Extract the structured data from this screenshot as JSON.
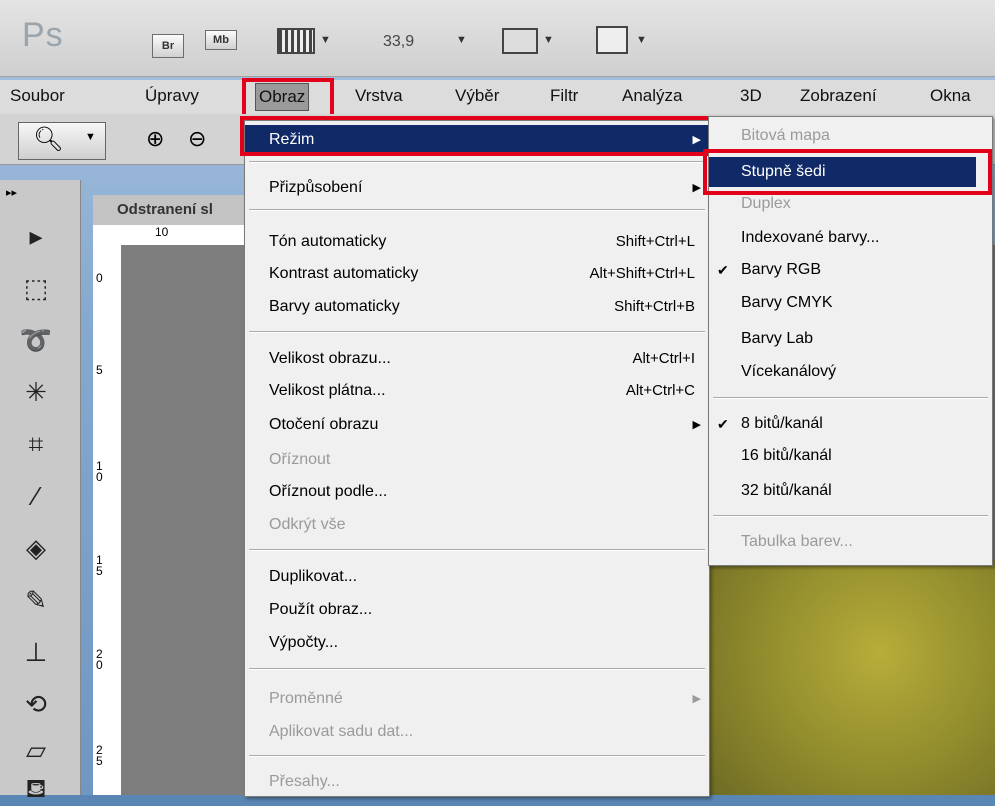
{
  "app": {
    "logo": "Ps",
    "bridge_label": "Br",
    "mini_bridge_label": "Mb",
    "zoom_value": "33,9"
  },
  "menubar": [
    {
      "label": "Soubor"
    },
    {
      "label": "Úpravy"
    },
    {
      "label": "Obraz"
    },
    {
      "label": "Vrstva"
    },
    {
      "label": "Výběr"
    },
    {
      "label": "Filtr"
    },
    {
      "label": "Analýza"
    },
    {
      "label": "3D"
    },
    {
      "label": "Zobrazení"
    },
    {
      "label": "Okna"
    }
  ],
  "document": {
    "tab_title": "Odstranení sl",
    "ruler_h_label": "10",
    "ruler_v_labels": [
      "0",
      "5",
      "1\n0",
      "1\n5",
      "2\n0",
      "2\n5"
    ]
  },
  "obraz_menu": {
    "items": [
      {
        "label": "Režim",
        "shortcut": "",
        "submenu": true,
        "disabled": false,
        "highlighted": true
      },
      {
        "label": "Přizpůsobení",
        "shortcut": "",
        "submenu": true,
        "disabled": false
      },
      {
        "label": "Tón automaticky",
        "shortcut": "Shift+Ctrl+L",
        "submenu": false,
        "disabled": false
      },
      {
        "label": "Kontrast automaticky",
        "shortcut": "Alt+Shift+Ctrl+L",
        "submenu": false,
        "disabled": false
      },
      {
        "label": "Barvy automaticky",
        "shortcut": "Shift+Ctrl+B",
        "submenu": false,
        "disabled": false
      },
      {
        "label": "Velikost obrazu...",
        "shortcut": "Alt+Ctrl+I",
        "submenu": false,
        "disabled": false
      },
      {
        "label": "Velikost plátna...",
        "shortcut": "Alt+Ctrl+C",
        "submenu": false,
        "disabled": false
      },
      {
        "label": "Otočení obrazu",
        "shortcut": "",
        "submenu": true,
        "disabled": false
      },
      {
        "label": "Oříznout",
        "shortcut": "",
        "submenu": false,
        "disabled": true
      },
      {
        "label": "Oříznout podle...",
        "shortcut": "",
        "submenu": false,
        "disabled": false
      },
      {
        "label": "Odkrýt vše",
        "shortcut": "",
        "submenu": false,
        "disabled": true
      },
      {
        "label": "Duplikovat...",
        "shortcut": "",
        "submenu": false,
        "disabled": false
      },
      {
        "label": "Použít obraz...",
        "shortcut": "",
        "submenu": false,
        "disabled": false
      },
      {
        "label": "Výpočty...",
        "shortcut": "",
        "submenu": false,
        "disabled": false
      },
      {
        "label": "Proměnné",
        "shortcut": "",
        "submenu": true,
        "disabled": true
      },
      {
        "label": "Aplikovat sadu dat...",
        "shortcut": "",
        "submenu": false,
        "disabled": true
      },
      {
        "label": "Přesahy...",
        "shortcut": "",
        "submenu": false,
        "disabled": true
      }
    ]
  },
  "rezim_submenu": {
    "items": [
      {
        "label": "Bitová mapa",
        "checked": false,
        "disabled": true
      },
      {
        "label": "Stupně šedi",
        "checked": false,
        "disabled": false,
        "highlighted": true
      },
      {
        "label": "Duplex",
        "checked": false,
        "disabled": true
      },
      {
        "label": "Indexované barvy...",
        "checked": false,
        "disabled": false
      },
      {
        "label": "Barvy RGB",
        "checked": true,
        "disabled": false
      },
      {
        "label": "Barvy CMYK",
        "checked": false,
        "disabled": false
      },
      {
        "label": "Barvy Lab",
        "checked": false,
        "disabled": false
      },
      {
        "label": "Vícekanálový",
        "checked": false,
        "disabled": false
      },
      {
        "label": "8 bitů/kanál",
        "checked": true,
        "disabled": false
      },
      {
        "label": "16 bitů/kanál",
        "checked": false,
        "disabled": false
      },
      {
        "label": "32 bitů/kanál",
        "checked": false,
        "disabled": false
      },
      {
        "label": "Tabulka barev...",
        "checked": false,
        "disabled": true
      }
    ]
  },
  "colors": {
    "highlight": "#0f2a66",
    "annotation_red": "#e3001b"
  }
}
